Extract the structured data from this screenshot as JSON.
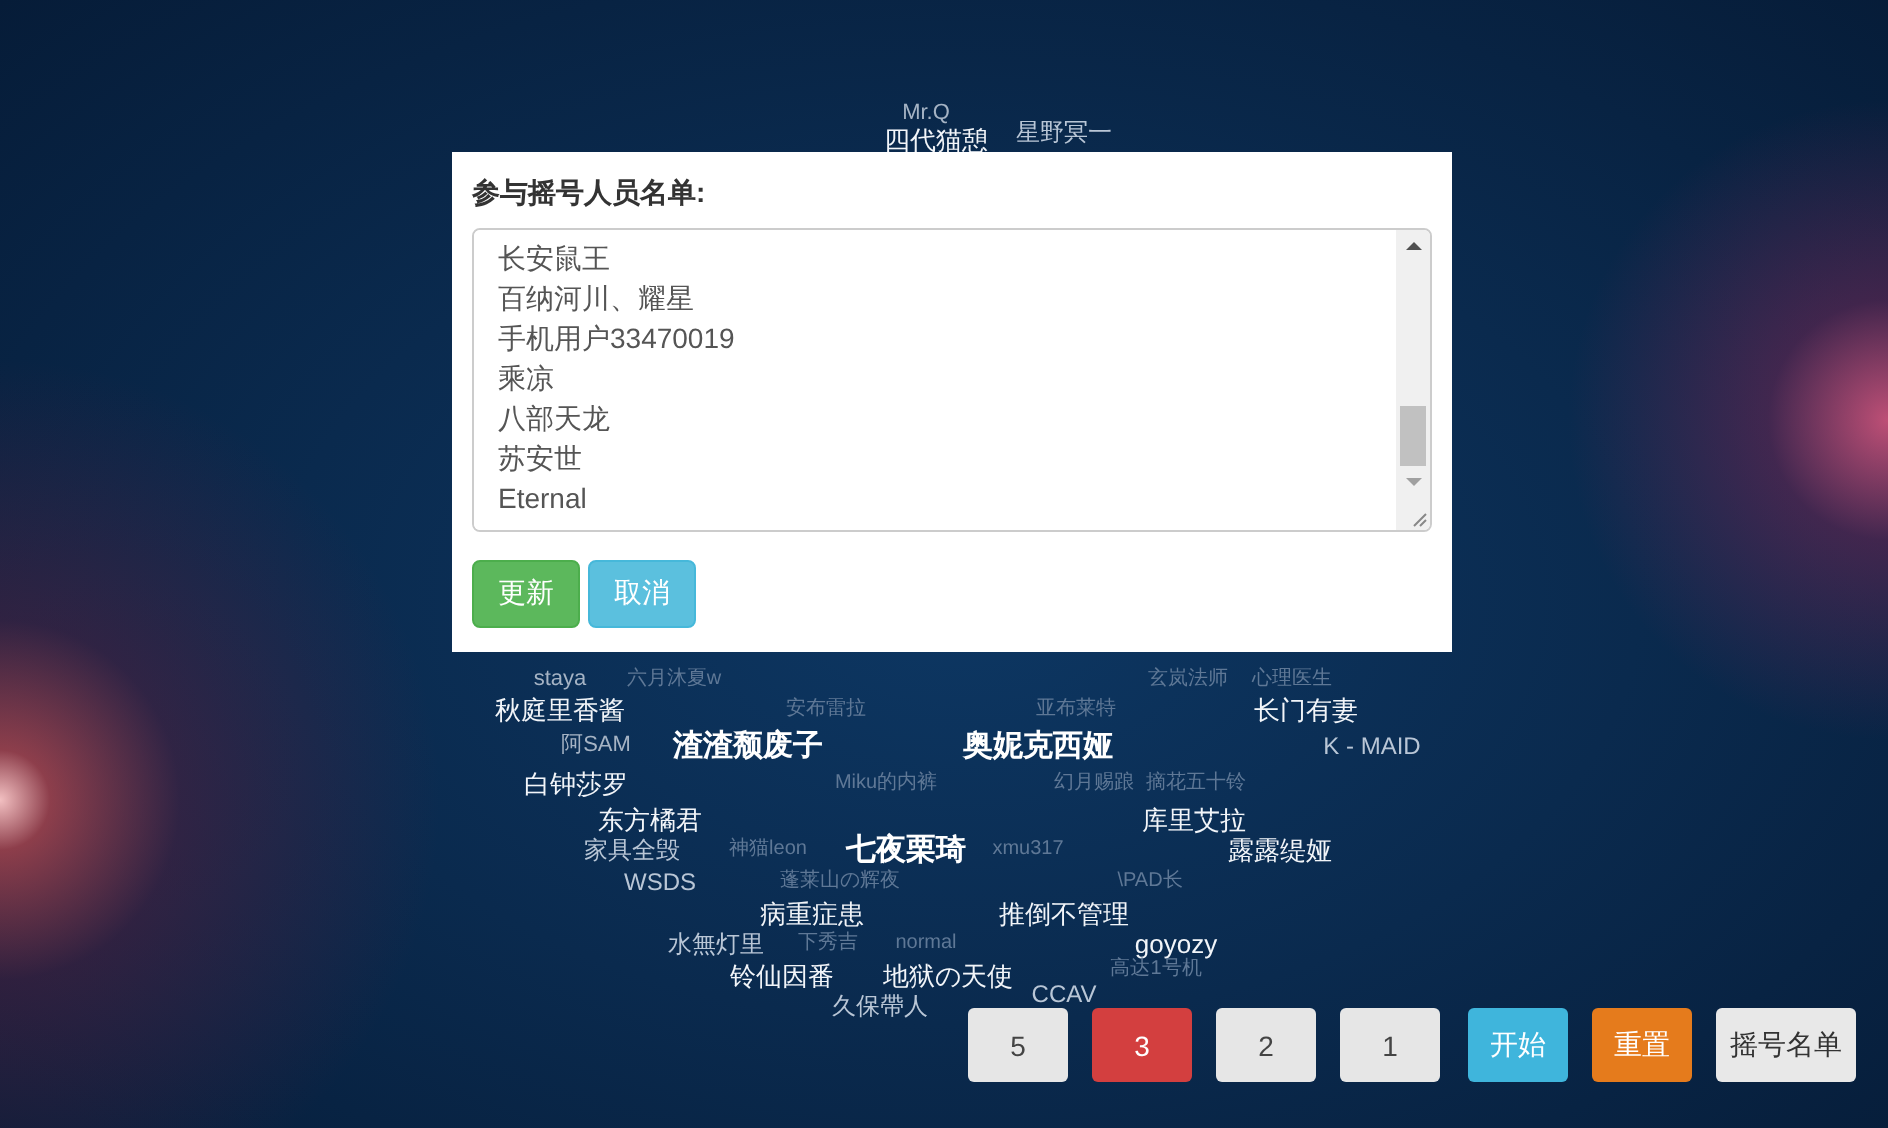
{
  "cloud_words": [
    {
      "text": "Mr.Q",
      "kind": "small"
    },
    {
      "text": "星野冥一",
      "kind": "medium"
    },
    {
      "text": "四代猫憩",
      "kind": "large"
    },
    {
      "text": "staya",
      "kind": "small"
    },
    {
      "text": "六月沐夏w",
      "kind": "faint"
    },
    {
      "text": "玄岚法师",
      "kind": "faint"
    },
    {
      "text": "心理医生",
      "kind": "faint"
    },
    {
      "text": "秋庭里香酱",
      "kind": "large"
    },
    {
      "text": "安布雷拉",
      "kind": "faint"
    },
    {
      "text": "亚布莱特",
      "kind": "faint"
    },
    {
      "text": "长门有妻",
      "kind": "large"
    },
    {
      "text": "阿SAM",
      "kind": "small"
    },
    {
      "text": "渣渣颓废子",
      "kind": "xlarge"
    },
    {
      "text": "奥妮克西娅",
      "kind": "xlarge"
    },
    {
      "text": "K - MAID",
      "kind": "medium"
    },
    {
      "text": "白钟莎罗",
      "kind": "large"
    },
    {
      "text": "Miku的内裤",
      "kind": "faint"
    },
    {
      "text": "幻月赐踉",
      "kind": "faint"
    },
    {
      "text": "摘花五十铃",
      "kind": "faint"
    },
    {
      "text": "东方橘君",
      "kind": "large"
    },
    {
      "text": "库里艾拉",
      "kind": "large"
    },
    {
      "text": "家具全毁",
      "kind": "medium"
    },
    {
      "text": "神猫leon",
      "kind": "faint"
    },
    {
      "text": "七夜栗琦",
      "kind": "xlarge"
    },
    {
      "text": "xmu317",
      "kind": "faint"
    },
    {
      "text": "露露缇娅",
      "kind": "large"
    },
    {
      "text": "WSDS",
      "kind": "medium"
    },
    {
      "text": "蓬莱山の辉夜",
      "kind": "faint"
    },
    {
      "text": "\\PAD长",
      "kind": "faint"
    },
    {
      "text": "病重症患",
      "kind": "large"
    },
    {
      "text": "推倒不管理",
      "kind": "large"
    },
    {
      "text": "水無灯里",
      "kind": "medium"
    },
    {
      "text": "下秀吉",
      "kind": "faint"
    },
    {
      "text": "normal",
      "kind": "faint"
    },
    {
      "text": "goyozy",
      "kind": "large"
    },
    {
      "text": "铃仙因番",
      "kind": "large"
    },
    {
      "text": "地狱の天使",
      "kind": "large"
    },
    {
      "text": "高达1号机",
      "kind": "faint"
    },
    {
      "text": "久保帶人",
      "kind": "medium"
    },
    {
      "text": "CCAV",
      "kind": "medium"
    }
  ],
  "dialog": {
    "title": "参与摇号人员名单:",
    "names": [
      "长安鼠王",
      "百纳河川、耀星",
      "手机用户33470019",
      "乘凉",
      "八部天龙",
      "苏安世",
      "Eternal"
    ],
    "buttons": [
      {
        "label": "更新",
        "kind": "success"
      },
      {
        "label": "取消",
        "kind": "info"
      }
    ]
  },
  "toolbar": [
    {
      "label": "5",
      "kind": "count",
      "selected": false
    },
    {
      "label": "3",
      "kind": "count",
      "selected": true
    },
    {
      "label": "2",
      "kind": "count",
      "selected": false
    },
    {
      "label": "1",
      "kind": "count",
      "selected": false
    },
    {
      "label": "开始",
      "kind": "start"
    },
    {
      "label": "重置",
      "kind": "reset"
    },
    {
      "label": "摇号名单",
      "kind": "list"
    }
  ]
}
